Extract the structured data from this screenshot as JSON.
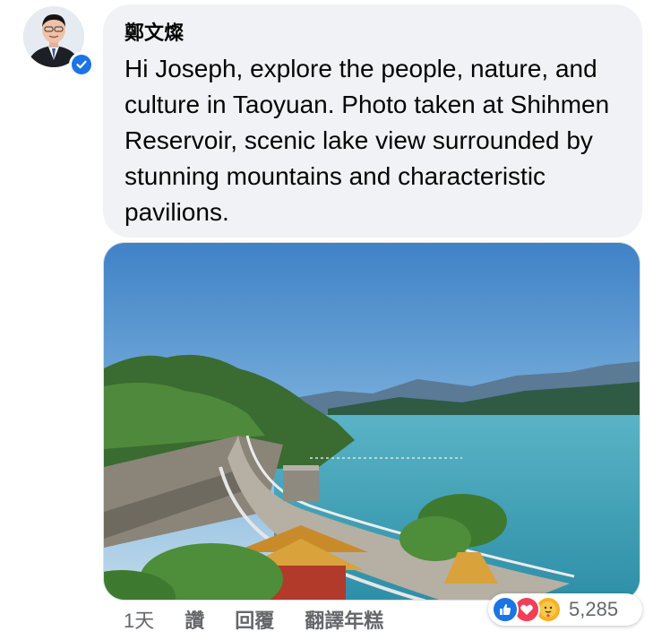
{
  "comment": {
    "author": "鄭文燦",
    "text": "Hi Joseph, explore the people, nature, and culture in Taoyuan. Photo taken at Shihmen Reservoir, scenic lake view surrounded by stunning mountains and characteristic pavilions.",
    "verified_icon": "verified-badge-icon",
    "avatar_icon": "profile-photo"
  },
  "photo": {
    "subject": "lake-reservoir-landscape"
  },
  "actions": {
    "timestamp": "1天",
    "like_label": "讚",
    "reply_label": "回覆",
    "translate_label": "翻譯年糕"
  },
  "reactions": {
    "icons": [
      "like-icon",
      "love-icon",
      "care-icon"
    ],
    "count": "5,285"
  },
  "colors": {
    "bubble": "#f0f2f5",
    "meta_text": "#65676b",
    "like_blue": "#1b74e4",
    "love_red": "#f33e58",
    "care_yellow": "#f7b125"
  }
}
